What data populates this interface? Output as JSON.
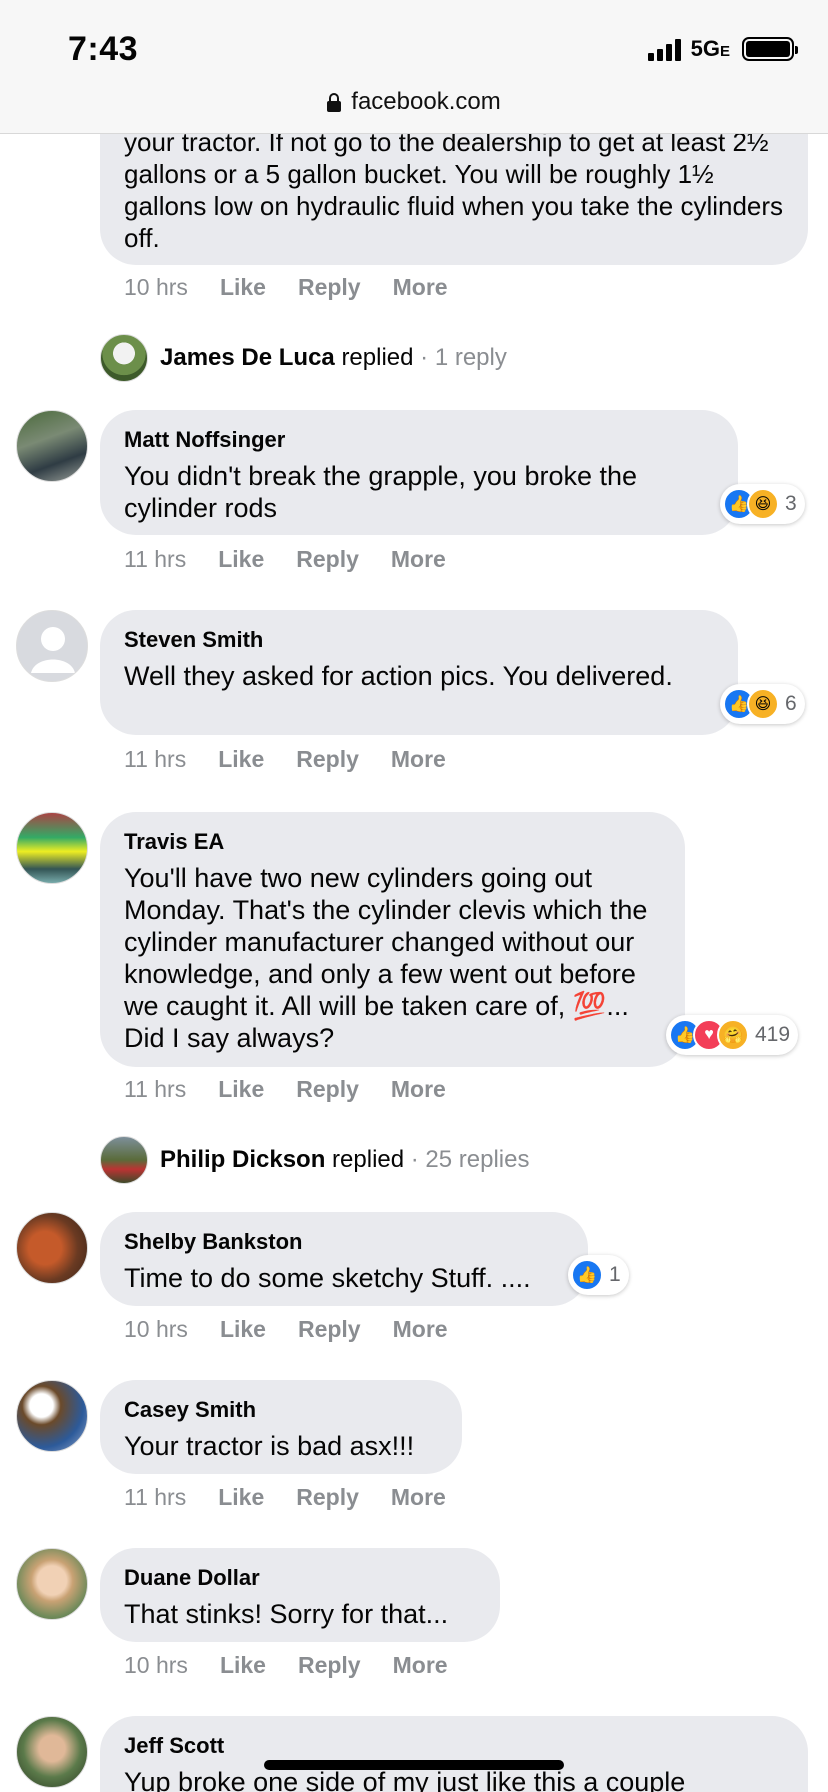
{
  "status_bar": {
    "time": "7:43",
    "network": "5G",
    "network_suffix": "E"
  },
  "url_bar": {
    "domain": "facebook.com"
  },
  "colors": {
    "bubble": "#e9eaee",
    "like_blue": "#1877f2",
    "meta_gray": "#8a8d91"
  },
  "action_labels": {
    "like": "Like",
    "reply": "Reply",
    "more": "More"
  },
  "top_comment": {
    "text": "your tractor. If not go to the dealership to get at least 2½ gallons or a 5 gallon bucket. You will be roughly 1½ gallons low on hydraulic fluid when you take the cylinders off.",
    "time": "10 hrs"
  },
  "reply_summary_1": {
    "name": "James De Luca",
    "verb": "replied",
    "count": "· 1 reply"
  },
  "comments": [
    {
      "name": "Matt Noffsinger",
      "text": "You didn't break the grapple, you broke the cylinder rods",
      "time": "11 hrs",
      "reactions": [
        "like",
        "haha"
      ],
      "reaction_count": "3"
    },
    {
      "name": "Steven Smith",
      "text": "Well they asked for action pics. You delivered.",
      "time": "11 hrs",
      "reactions": [
        "like",
        "haha"
      ],
      "reaction_count": "6"
    },
    {
      "name": "Travis EA",
      "text": "You'll have two new cylinders going out Monday. That's the cylinder clevis which the cylinder manufacturer changed without our knowledge, and only a few went out before we caught it. All will be taken care of, 💯... Did I say always?",
      "time": "11 hrs",
      "reactions": [
        "like",
        "love",
        "care"
      ],
      "reaction_count": "419"
    },
    {
      "name": "Shelby Bankston",
      "text": "Time to do some sketchy Stuff. ....",
      "time": "10 hrs",
      "reactions": [
        "like"
      ],
      "reaction_count": "1"
    },
    {
      "name": "Casey Smith",
      "text": "Your tractor is bad asx!!!",
      "time": "11 hrs"
    },
    {
      "name": "Duane Dollar",
      "text": "That stinks! Sorry for that...",
      "time": "10 hrs"
    },
    {
      "name": "Jeff Scott",
      "text": "Yup broke one side of my just like this a couple"
    }
  ],
  "reply_summary_2": {
    "name": "Philip Dickson",
    "verb": "replied",
    "count": "· 25 replies"
  }
}
